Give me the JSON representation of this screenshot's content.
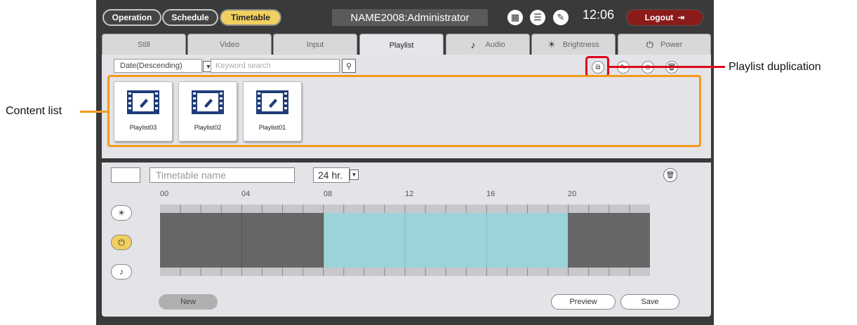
{
  "header": {
    "nav_buttons": [
      "Operation",
      "Schedule",
      "Timetable"
    ],
    "account": "NAME2008:Administrator",
    "clock": "12:06",
    "logout_label": "Logout",
    "icons": [
      "display-icon",
      "list-icon",
      "wrench-icon",
      "logout-icon"
    ]
  },
  "tabs": [
    "Still",
    "Video",
    "Input",
    "Playlist",
    "Audio",
    "Brightness",
    "Power"
  ],
  "active_tab": "Playlist",
  "content_toolbar": {
    "sort_value": "Date(Descending)",
    "search_placeholder": "Keyword search"
  },
  "playlists": [
    "Playlist03",
    "Playlist02",
    "Playlist01"
  ],
  "timetable": {
    "name_placeholder": "Timetable name",
    "format_value": "24 hr.",
    "hours": [
      "00",
      "04",
      "08",
      "12",
      "16",
      "20"
    ],
    "active_span": {
      "from": 8,
      "to": 20
    }
  },
  "buttons": {
    "new": "New",
    "preview": "Preview",
    "save": "Save"
  },
  "annotations": {
    "content_list": "Content list",
    "playlist_duplication": "Playlist duplication"
  },
  "colors": {
    "active_nav": "#f0d060",
    "logout_bg": "#8b1a1a",
    "highlight_content": "#f39a1c",
    "highlight_duplicate": "#e0001b",
    "timeline_active": "#9bd3d8",
    "timeline_inactive": "#666666"
  }
}
